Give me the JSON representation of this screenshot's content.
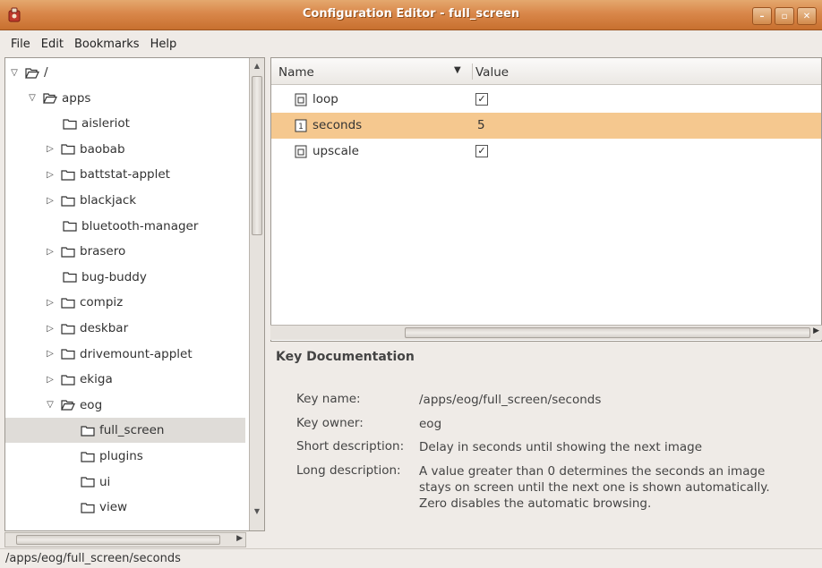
{
  "window": {
    "title": "Configuration Editor - full_screen"
  },
  "menubar": {
    "items": [
      {
        "label": "File"
      },
      {
        "label": "Edit"
      },
      {
        "label": "Bookmarks"
      },
      {
        "label": "Help"
      }
    ]
  },
  "tree": {
    "items": [
      {
        "label": "/",
        "expander": "open"
      },
      {
        "label": "apps",
        "expander": "open"
      },
      {
        "label": "aisleriot",
        "expander": "none"
      },
      {
        "label": "baobab",
        "expander": "closed"
      },
      {
        "label": "battstat-applet",
        "expander": "closed"
      },
      {
        "label": "blackjack",
        "expander": "closed"
      },
      {
        "label": "bluetooth-manager",
        "expander": "none"
      },
      {
        "label": "brasero",
        "expander": "closed"
      },
      {
        "label": "bug-buddy",
        "expander": "none"
      },
      {
        "label": "compiz",
        "expander": "closed"
      },
      {
        "label": "deskbar",
        "expander": "closed"
      },
      {
        "label": "drivemount-applet",
        "expander": "closed"
      },
      {
        "label": "ekiga",
        "expander": "closed"
      },
      {
        "label": "eog",
        "expander": "open"
      },
      {
        "label": "full_screen",
        "expander": "none",
        "selected": true
      },
      {
        "label": "plugins",
        "expander": "none"
      },
      {
        "label": "ui",
        "expander": "none"
      },
      {
        "label": "view",
        "expander": "none"
      }
    ]
  },
  "keys": {
    "columns": {
      "name": "Name",
      "value": "Value"
    },
    "rows": [
      {
        "name": "loop",
        "type": "bool",
        "checked": true,
        "value": "✓"
      },
      {
        "name": "seconds",
        "type": "int",
        "value": "5",
        "selected": true
      },
      {
        "name": "upscale",
        "type": "bool",
        "checked": true,
        "value": "✓"
      }
    ]
  },
  "documentation": {
    "title": "Key Documentation",
    "key_name_label": "Key name:",
    "key_name": "/apps/eog/full_screen/seconds",
    "key_owner_label": "Key owner:",
    "key_owner": "eog",
    "short_desc_label": "Short description:",
    "short_desc": "Delay in seconds until showing the next image",
    "long_desc_label": "Long description:",
    "long_desc_lines": [
      "A value greater than 0 determines the seconds an image",
      "stays on screen until the next one is shown automatically.",
      "Zero disables the automatic browsing."
    ]
  },
  "statusbar": {
    "text": "/apps/eog/full_screen/seconds"
  },
  "colors": {
    "titlebar": "#d9874a",
    "selection_row": "#f5c88f",
    "tree_selection": "#dfdcd8"
  }
}
